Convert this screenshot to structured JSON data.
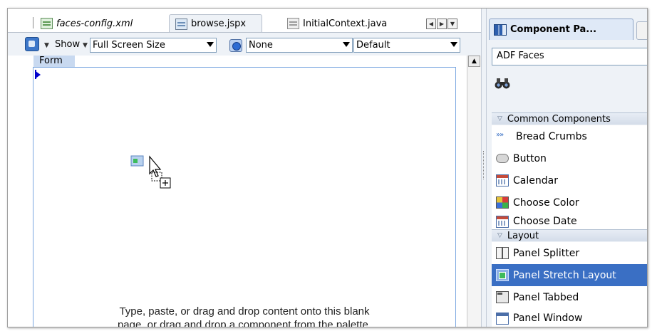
{
  "editor": {
    "tabs": [
      {
        "label": "faces-config.xml",
        "icon": "xml-file-icon"
      },
      {
        "label": "browse.jspx",
        "icon": "jspx-file-icon",
        "active": true
      },
      {
        "label": "InitialContext.java",
        "icon": "java-file-icon"
      }
    ],
    "nav_buttons": [
      "◀",
      "▶",
      "▼"
    ]
  },
  "toolbar": {
    "show_label": "Show",
    "screen_size": "Full Screen Size",
    "skin": "None",
    "style": "Default"
  },
  "canvas": {
    "form_label": "Form",
    "hint_line1": "Type, paste, or drag and drop content onto this blank",
    "hint_line2": "page, or drag and drop a component from the palette."
  },
  "palette": {
    "tab_title": "Component Pa...",
    "library": "ADF Faces",
    "sections": [
      {
        "title": "Common Components",
        "items": [
          {
            "label": "Bread Crumbs",
            "icon": "bread-crumbs-icon"
          },
          {
            "label": "Button",
            "icon": "button-icon"
          },
          {
            "label": "Calendar",
            "icon": "calendar-icon"
          },
          {
            "label": "Choose Color",
            "icon": "color-palette-icon"
          },
          {
            "label": "Choose Date",
            "icon": "date-picker-icon"
          }
        ]
      },
      {
        "title": "Layout",
        "items": [
          {
            "label": "Panel Splitter",
            "icon": "panel-splitter-icon"
          },
          {
            "label": "Panel Stretch Layout",
            "icon": "panel-stretch-layout-icon",
            "selected": true
          },
          {
            "label": "Panel Tabbed",
            "icon": "panel-tabbed-icon"
          },
          {
            "label": "Panel Window",
            "icon": "panel-window-icon"
          }
        ]
      }
    ]
  },
  "colors": {
    "selection": "#3a6fc4",
    "form_border": "#7aa7e0",
    "form_label_bg": "#c8d9f0",
    "panel_bg": "#eef2f7"
  }
}
